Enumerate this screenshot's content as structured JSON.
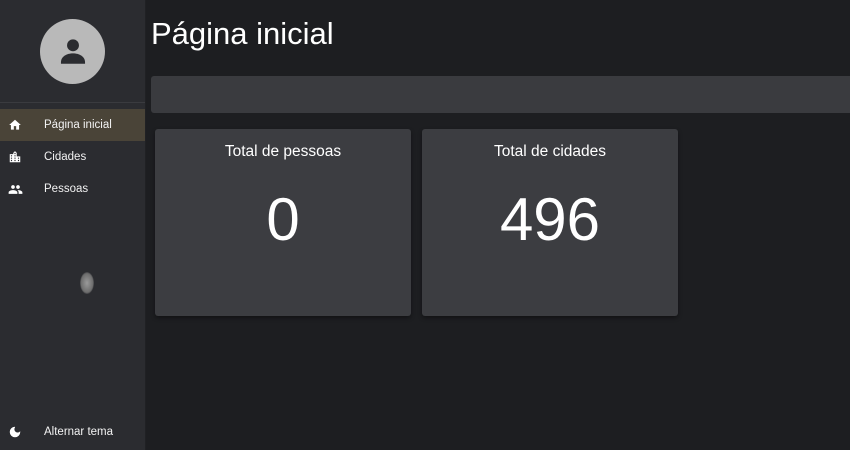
{
  "header": {
    "title": "Página inicial"
  },
  "sidebar": {
    "avatar_icon": "account-circle-icon",
    "items": [
      {
        "label": "Página inicial",
        "icon": "home-icon",
        "active": true
      },
      {
        "label": "Cidades",
        "icon": "city-icon",
        "active": false
      },
      {
        "label": "Pessoas",
        "icon": "people-icon",
        "active": false
      }
    ],
    "theme_toggle": {
      "label": "Alternar tema",
      "icon": "moon-icon"
    }
  },
  "dashboard": {
    "cards": [
      {
        "title": "Total de pessoas",
        "value": "0"
      },
      {
        "title": "Total de cidades",
        "value": "496"
      }
    ]
  },
  "colors": {
    "background": "#1d1e21",
    "sidebar": "#2b2c30",
    "card": "#3c3d41",
    "active_item": "#4a4438"
  }
}
